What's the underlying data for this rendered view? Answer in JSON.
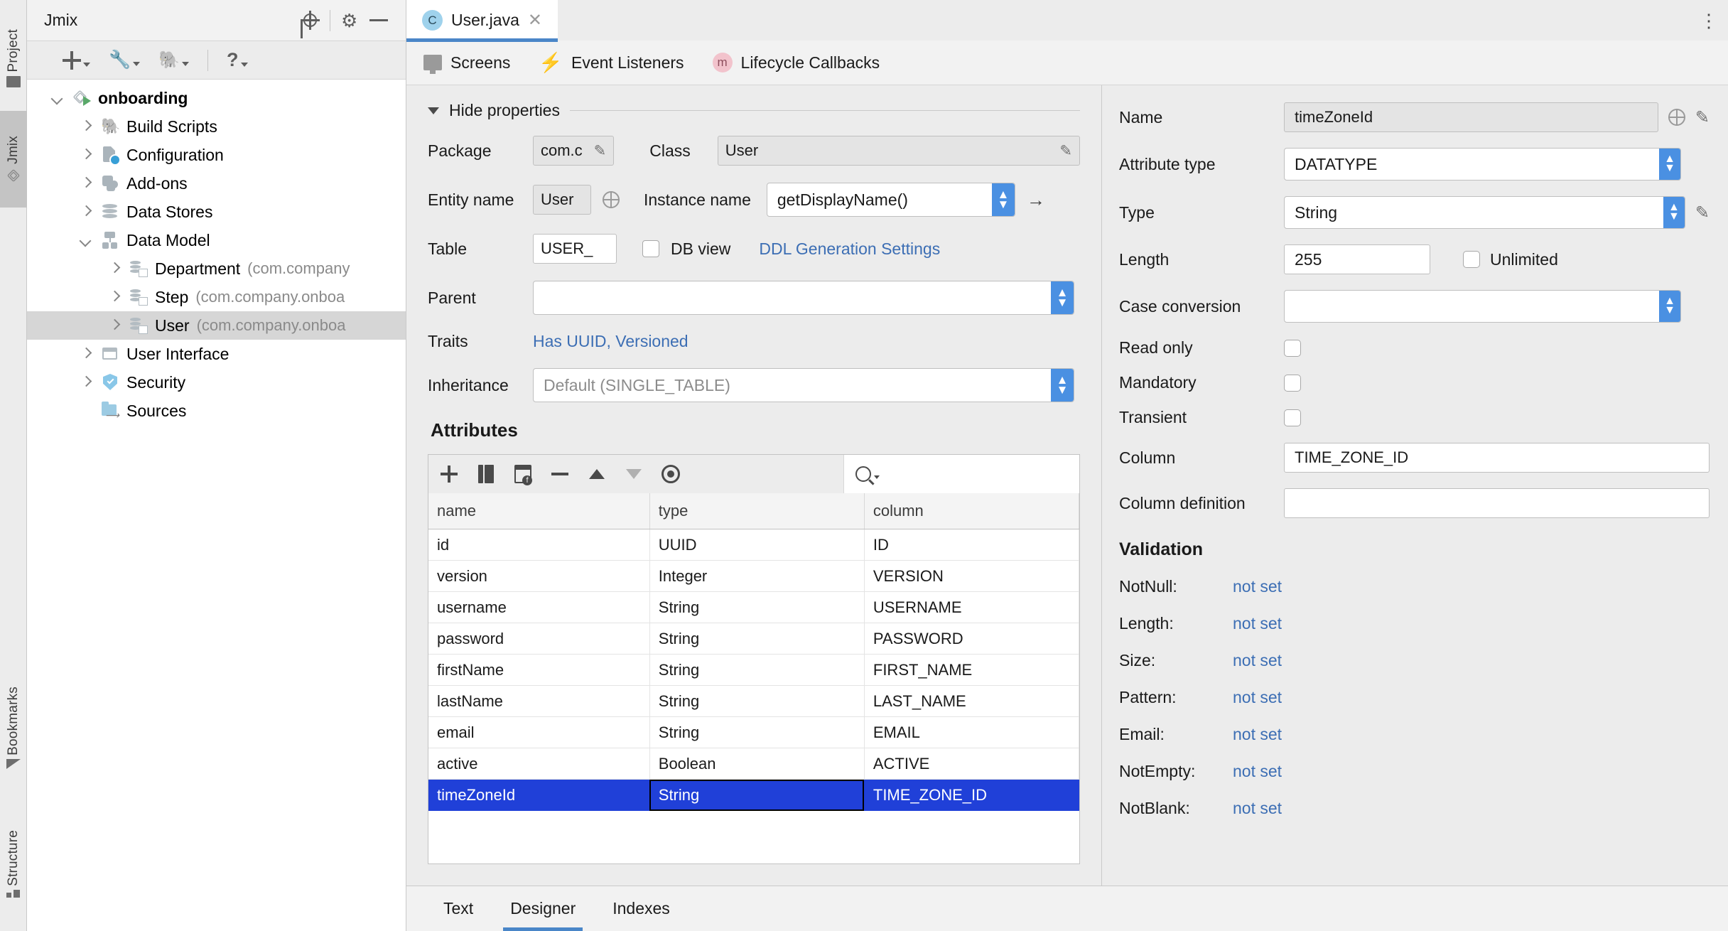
{
  "left_strip": {
    "tabs": [
      {
        "label": "Project",
        "icon": "folder-icon",
        "active": false
      },
      {
        "label": "Jmix",
        "icon": "jmix-icon",
        "active": true
      },
      {
        "label": "Bookmarks",
        "icon": "bookmark-icon",
        "active": false
      },
      {
        "label": "Structure",
        "icon": "structure-icon",
        "active": false
      }
    ]
  },
  "project_panel": {
    "title": "Jmix",
    "header_buttons": [
      "locate-icon",
      "gear-icon",
      "minimize-icon"
    ],
    "toolbar_buttons": [
      "add-icon",
      "wrench-icon",
      "gradle-icon",
      "help-icon"
    ],
    "tree": [
      {
        "label": "onboarding",
        "pkg": "",
        "icon": "module-icon",
        "indent": 0,
        "expand": "open",
        "bold": true,
        "selected": false
      },
      {
        "label": "Build Scripts",
        "pkg": "",
        "icon": "gradle-icon",
        "indent": 1,
        "expand": "closed",
        "bold": false,
        "selected": false
      },
      {
        "label": "Configuration",
        "pkg": "",
        "icon": "configuration-icon",
        "indent": 1,
        "expand": "closed",
        "bold": false,
        "selected": false
      },
      {
        "label": "Add-ons",
        "pkg": "",
        "icon": "addons-icon",
        "indent": 1,
        "expand": "closed",
        "bold": false,
        "selected": false
      },
      {
        "label": "Data Stores",
        "pkg": "",
        "icon": "datastore-icon",
        "indent": 1,
        "expand": "closed",
        "bold": false,
        "selected": false
      },
      {
        "label": "Data Model",
        "pkg": "",
        "icon": "datamodel-icon",
        "indent": 1,
        "expand": "open",
        "bold": false,
        "selected": false
      },
      {
        "label": "Department",
        "pkg": "(com.company",
        "icon": "entity-icon",
        "indent": 2,
        "expand": "closed",
        "bold": false,
        "selected": false
      },
      {
        "label": "Step",
        "pkg": "(com.company.onboa",
        "icon": "entity-icon",
        "indent": 2,
        "expand": "closed",
        "bold": false,
        "selected": false
      },
      {
        "label": "User",
        "pkg": "(com.company.onboa",
        "icon": "entity-icon",
        "indent": 2,
        "expand": "closed",
        "bold": false,
        "selected": true
      },
      {
        "label": "User Interface",
        "pkg": "",
        "icon": "userinterface-icon",
        "indent": 1,
        "expand": "closed",
        "bold": false,
        "selected": false
      },
      {
        "label": "Security",
        "pkg": "",
        "icon": "security-icon",
        "indent": 1,
        "expand": "closed",
        "bold": false,
        "selected": false
      },
      {
        "label": "Sources",
        "pkg": "",
        "icon": "sources-icon",
        "indent": 1,
        "expand": "none",
        "bold": false,
        "selected": false
      }
    ]
  },
  "editor": {
    "file_tab": {
      "label": "User.java",
      "icon": "java-class-icon",
      "close": "✕"
    },
    "overflow": "⋮",
    "sub_tabs": [
      {
        "label": "Screens",
        "icon": "screen-icon"
      },
      {
        "label": "Event Listeners",
        "icon": "bolt-icon"
      },
      {
        "label": "Lifecycle Callbacks",
        "icon": "method-icon"
      }
    ]
  },
  "designer": {
    "hide_properties_label": "Hide properties",
    "package_label": "Package",
    "package_value": "com.c",
    "class_label": "Class",
    "class_value": "User",
    "entity_name_label": "Entity name",
    "entity_name_value": "User",
    "instance_name_label": "Instance name",
    "instance_name_value": "getDisplayName()",
    "table_label": "Table",
    "table_value": "USER_",
    "db_view_label": "DB view",
    "ddl_link": "DDL Generation Settings",
    "parent_label": "Parent",
    "parent_value": "",
    "traits_label": "Traits",
    "traits_value": "Has UUID, Versioned",
    "inheritance_label": "Inheritance",
    "inheritance_value": "Default (SINGLE_TABLE)",
    "attributes_title": "Attributes",
    "table_toolbar": [
      "add-attribute-icon",
      "copy-attribute-icon",
      "composition-attribute-icon",
      "remove-attribute-icon",
      "move-up-icon",
      "move-down-icon",
      "view-icon"
    ],
    "search_placeholder": "",
    "columns": [
      "name",
      "type",
      "column"
    ],
    "rows": [
      {
        "name": "id",
        "type": "UUID",
        "column": "ID",
        "selected": false
      },
      {
        "name": "version",
        "type": "Integer",
        "column": "VERSION",
        "selected": false
      },
      {
        "name": "username",
        "type": "String",
        "column": "USERNAME",
        "selected": false
      },
      {
        "name": "password",
        "type": "String",
        "column": "PASSWORD",
        "selected": false
      },
      {
        "name": "firstName",
        "type": "String",
        "column": "FIRST_NAME",
        "selected": false
      },
      {
        "name": "lastName",
        "type": "String",
        "column": "LAST_NAME",
        "selected": false
      },
      {
        "name": "email",
        "type": "String",
        "column": "EMAIL",
        "selected": false
      },
      {
        "name": "active",
        "type": "Boolean",
        "column": "ACTIVE",
        "selected": false
      },
      {
        "name": "timeZoneId",
        "type": "String",
        "column": "TIME_ZONE_ID",
        "selected": true
      }
    ]
  },
  "inspector": {
    "name_label": "Name",
    "name_value": "timeZoneId",
    "attribute_type_label": "Attribute type",
    "attribute_type_value": "DATATYPE",
    "type_label": "Type",
    "type_value": "String",
    "length_label": "Length",
    "length_value": "255",
    "unlimited_label": "Unlimited",
    "case_conversion_label": "Case conversion",
    "case_conversion_value": "",
    "read_only_label": "Read only",
    "mandatory_label": "Mandatory",
    "transient_label": "Transient",
    "column_label": "Column",
    "column_value": "TIME_ZONE_ID",
    "column_definition_label": "Column definition",
    "column_definition_value": "",
    "validation_title": "Validation",
    "validations": [
      {
        "label": "NotNull:",
        "value": "not set"
      },
      {
        "label": "Length:",
        "value": "not set"
      },
      {
        "label": "Size:",
        "value": "not set"
      },
      {
        "label": "Pattern:",
        "value": "not set"
      },
      {
        "label": "Email:",
        "value": "not set"
      },
      {
        "label": "NotEmpty:",
        "value": "not set"
      },
      {
        "label": "NotBlank:",
        "value": "not set"
      }
    ]
  },
  "bottom_tabs": [
    {
      "label": "Text",
      "active": false
    },
    {
      "label": "Designer",
      "active": true
    },
    {
      "label": "Indexes",
      "active": false
    }
  ],
  "colors": {
    "accent_blue": "#4a86c8",
    "selection_blue": "#2040d8",
    "link_blue": "#3c6eb4",
    "spinner_blue": "#4a90e2",
    "panel_bg": "#ececec"
  }
}
